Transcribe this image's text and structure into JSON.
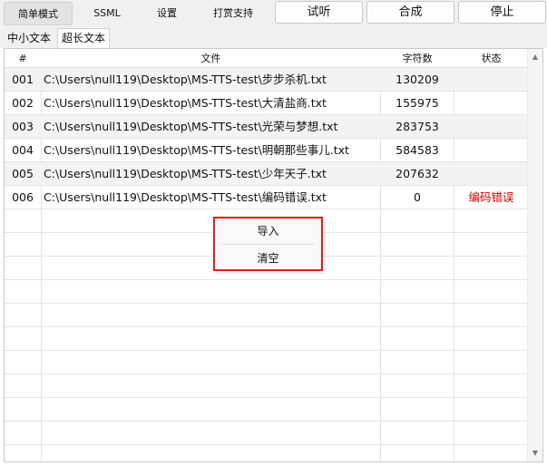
{
  "mode_tabs": [
    {
      "label": "简单模式",
      "active": true
    },
    {
      "label": "SSML",
      "active": false
    },
    {
      "label": "设置",
      "active": false
    },
    {
      "label": "打赏支持",
      "active": false
    }
  ],
  "actions": {
    "audition_label": "试听",
    "synthesize_label": "合成",
    "stop_label": "停止"
  },
  "sub_tabs": [
    {
      "label": "中小文本",
      "active": false
    },
    {
      "label": "超长文本",
      "active": true
    }
  ],
  "table": {
    "headers": {
      "index": "#",
      "file": "文件",
      "char_count": "字符数",
      "status": "状态"
    },
    "rows": [
      {
        "index": "001",
        "file": "C:\\Users\\null119\\Desktop\\MS-TTS-test\\步步杀机.txt",
        "char_count": "130209",
        "status": ""
      },
      {
        "index": "002",
        "file": "C:\\Users\\null119\\Desktop\\MS-TTS-test\\大清盐商.txt",
        "char_count": "155975",
        "status": ""
      },
      {
        "index": "003",
        "file": "C:\\Users\\null119\\Desktop\\MS-TTS-test\\光荣与梦想.txt",
        "char_count": "283753",
        "status": ""
      },
      {
        "index": "004",
        "file": "C:\\Users\\null119\\Desktop\\MS-TTS-test\\明朝那些事儿.txt",
        "char_count": "584583",
        "status": ""
      },
      {
        "index": "005",
        "file": "C:\\Users\\null119\\Desktop\\MS-TTS-test\\少年天子.txt",
        "char_count": "207632",
        "status": ""
      },
      {
        "index": "006",
        "file": "C:\\Users\\null119\\Desktop\\MS-TTS-test\\编码错误.txt",
        "char_count": "0",
        "status": "编码错误"
      }
    ]
  },
  "context_menu": {
    "import_label": "导入",
    "clear_label": "清空"
  },
  "colors": {
    "error": "#d40000",
    "highlight_border": "#e02020"
  },
  "icons": {
    "scroll_up": "scroll-up-arrow-icon",
    "scroll_down": "scroll-down-arrow-icon"
  }
}
